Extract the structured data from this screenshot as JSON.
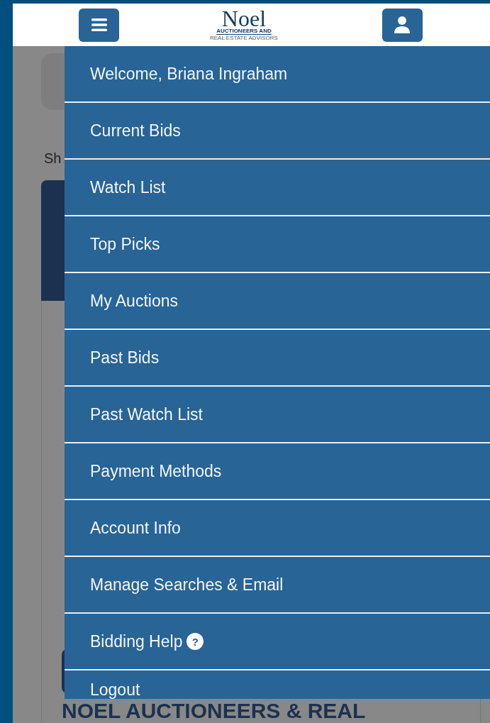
{
  "header": {
    "logo": {
      "name": "Noel",
      "line_1": "AUCTIONEERS AND",
      "line_2": "REAL ESTATE ADVISORS"
    }
  },
  "background": {
    "partial_text": "Sh",
    "heading": "NOEL AUCTIONEERS & REAL"
  },
  "menu": {
    "items": [
      {
        "label": "Welcome, Briana Ingraham"
      },
      {
        "label": "Current Bids"
      },
      {
        "label": "Watch List"
      },
      {
        "label": "Top Picks"
      },
      {
        "label": "My Auctions"
      },
      {
        "label": "Past Bids"
      },
      {
        "label": "Past Watch List"
      },
      {
        "label": "Payment Methods"
      },
      {
        "label": "Account Info"
      },
      {
        "label": "Manage Searches & Email"
      },
      {
        "label": "Bidding Help",
        "help_badge": "?"
      },
      {
        "label": "Logout"
      }
    ]
  }
}
